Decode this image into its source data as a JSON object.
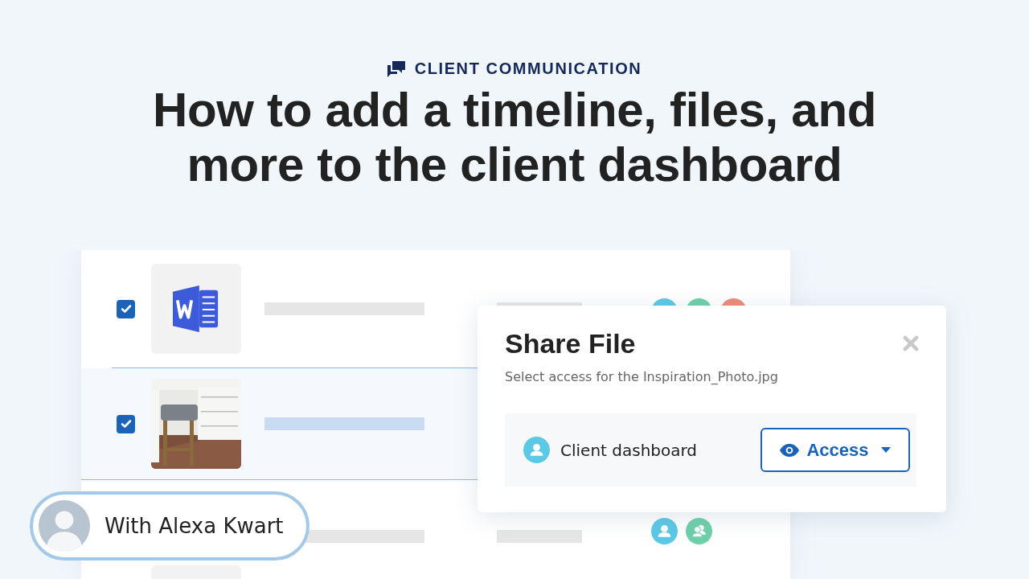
{
  "header": {
    "category": "CLIENT COMMUNICATION",
    "title": "How to add a timeline, files, and more to the client dashboard"
  },
  "rows": [
    {
      "kind": "document",
      "checked": true,
      "selected": false,
      "avatars": [
        {
          "kind": "plain",
          "color": "#5bc8e6"
        },
        {
          "kind": "plain",
          "color": "#6dd0a9"
        },
        {
          "kind": "plain",
          "color": "#ef8a78"
        }
      ]
    },
    {
      "kind": "picture",
      "checked": true,
      "selected": true,
      "avatars": []
    },
    {
      "kind": "blank",
      "selected": false,
      "avatars": [
        {
          "kind": "person",
          "color": "#5bc8e6"
        },
        {
          "kind": "group",
          "color": "#6dd0a9"
        }
      ]
    }
  ],
  "dialog": {
    "title": "Share File",
    "subtitle": "Select access for the Inspiration_Photo.jpg",
    "recipient": "Client dashboard",
    "button": "Access"
  },
  "presenter": {
    "label": "With Alexa Kwart"
  }
}
